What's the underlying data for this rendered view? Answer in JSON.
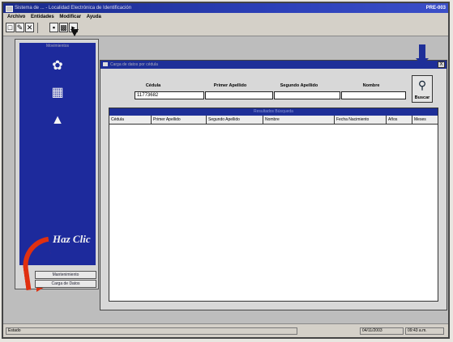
{
  "window": {
    "title": "Sistema de ... - Localidad Electrónica de Identificación",
    "right_text": "PRE-003"
  },
  "menu": {
    "items": [
      "Archivo",
      "Entidades",
      "Modificar",
      "Ayuda"
    ]
  },
  "sidebar": {
    "header": "Movimientos",
    "hint": "Haz Clic",
    "links": [
      "Mantenimiento",
      "Carga de Datos"
    ],
    "icons": [
      "fingerprint-icon",
      "book-icon",
      "person-icon"
    ]
  },
  "dialog": {
    "title": "Carga de datos por cédula",
    "close_label": "X",
    "fields": {
      "cedula": {
        "label": "Cédula",
        "value": "11773682"
      },
      "primer_apellido": {
        "label": "Primer Apellido",
        "value": ""
      },
      "segundo_apellido": {
        "label": "Segundo Apellido",
        "value": ""
      },
      "nombre": {
        "label": "Nombre",
        "value": ""
      }
    },
    "buscar_label": "Buscar",
    "results": {
      "title": "Resultados Búsqueda",
      "columns": [
        "Cédula",
        "Primer Apellido",
        "Segundo Apellido",
        "Nombre",
        "Fecha Nacimiento",
        "Años",
        "Meses"
      ]
    }
  },
  "status": {
    "left": "Estado",
    "date": "04/11/2003",
    "time": "09:43 a.m."
  }
}
